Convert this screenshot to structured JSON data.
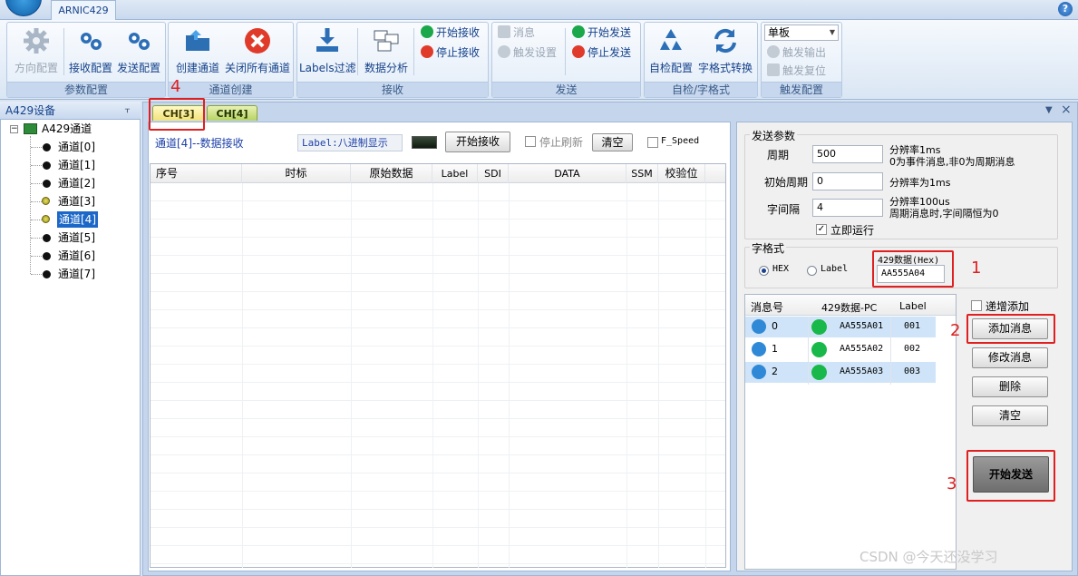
{
  "app": {
    "tab_label": "ARNIC429",
    "help": "?"
  },
  "ribbon": {
    "groups": {
      "param": "参数配置",
      "channel": "通道创建",
      "receive": "接收",
      "send": "发送",
      "selftest": "自检/字格式",
      "trigger": "触发配置"
    },
    "buttons": {
      "direction": "方向配置",
      "rx_config": "接收配置",
      "tx_config": "发送配置",
      "create_channel": "创建通道",
      "close_all": "关闭所有通道",
      "labels_filter": "Labels过滤",
      "data_analysis": "数据分析",
      "start_rx": "开始接收",
      "stop_rx": "停止接收",
      "message": "消息",
      "trigger_setting": "触发设置",
      "start_tx": "开始发送",
      "stop_tx": "停止发送",
      "selftest_config": "自检配置",
      "format_convert": "字格式转换",
      "board_select": "单板",
      "trigger_output": "触发输出",
      "trigger_reset": "触发复位"
    }
  },
  "tree": {
    "header": "A429设备",
    "pin": "ᚁ",
    "root": "A429通道",
    "channels": [
      "通道[0]",
      "通道[1]",
      "通道[2]",
      "通道[3]",
      "通道[4]",
      "通道[5]",
      "通道[6]",
      "通道[7]"
    ]
  },
  "doc_tabs": [
    "CH[3]",
    "CH[4]"
  ],
  "receive": {
    "title": "通道[4]--数据接收",
    "label_mode": "Label:八进制显示",
    "start_button": "开始接收",
    "stop_refresh": "停止刷新",
    "clear_button": "清空",
    "fspeed": "F_Speed",
    "columns": [
      "序号",
      "时标",
      "原始数据",
      "Label",
      "SDI",
      "DATA",
      "SSM",
      "校验位"
    ]
  },
  "send": {
    "params_legend": "发送参数",
    "period_label": "周期",
    "period_value": "500",
    "period_note1": "分辨率1ms",
    "period_note2": "0为事件消息,非0为周期消息",
    "init_period_label": "初始周期",
    "init_period_value": "0",
    "init_period_note": "分辨率为1ms",
    "word_gap_label": "字间隔",
    "word_gap_value": "4",
    "word_gap_note1": "分辨率100us",
    "word_gap_note2": "周期消息时,字间隔恒为0",
    "run_now": "立即运行",
    "format_legend": "字格式",
    "hex": "HEX",
    "label": "Label",
    "data_label": "429数据(Hex)",
    "data_value": "AA555A04",
    "list_columns": [
      "消息号",
      "429数据-PC",
      "Label"
    ],
    "messages": [
      {
        "id": "0",
        "data": "AA555A01",
        "label": "001"
      },
      {
        "id": "1",
        "data": "AA555A02",
        "label": "002"
      },
      {
        "id": "2",
        "data": "AA555A03",
        "label": "003"
      }
    ],
    "incremental_add": "递增添加",
    "add_msg": "添加消息",
    "modify_msg": "修改消息",
    "delete": "删除",
    "clear": "清空",
    "start_send": "开始发送"
  },
  "annotations": [
    "1",
    "2",
    "3",
    "4"
  ],
  "watermark": "CSDN @今天还没学习",
  "colors": {
    "accent": "#15428b",
    "annotation": "#e02020",
    "ribbon_bg": "#dae6f4"
  }
}
